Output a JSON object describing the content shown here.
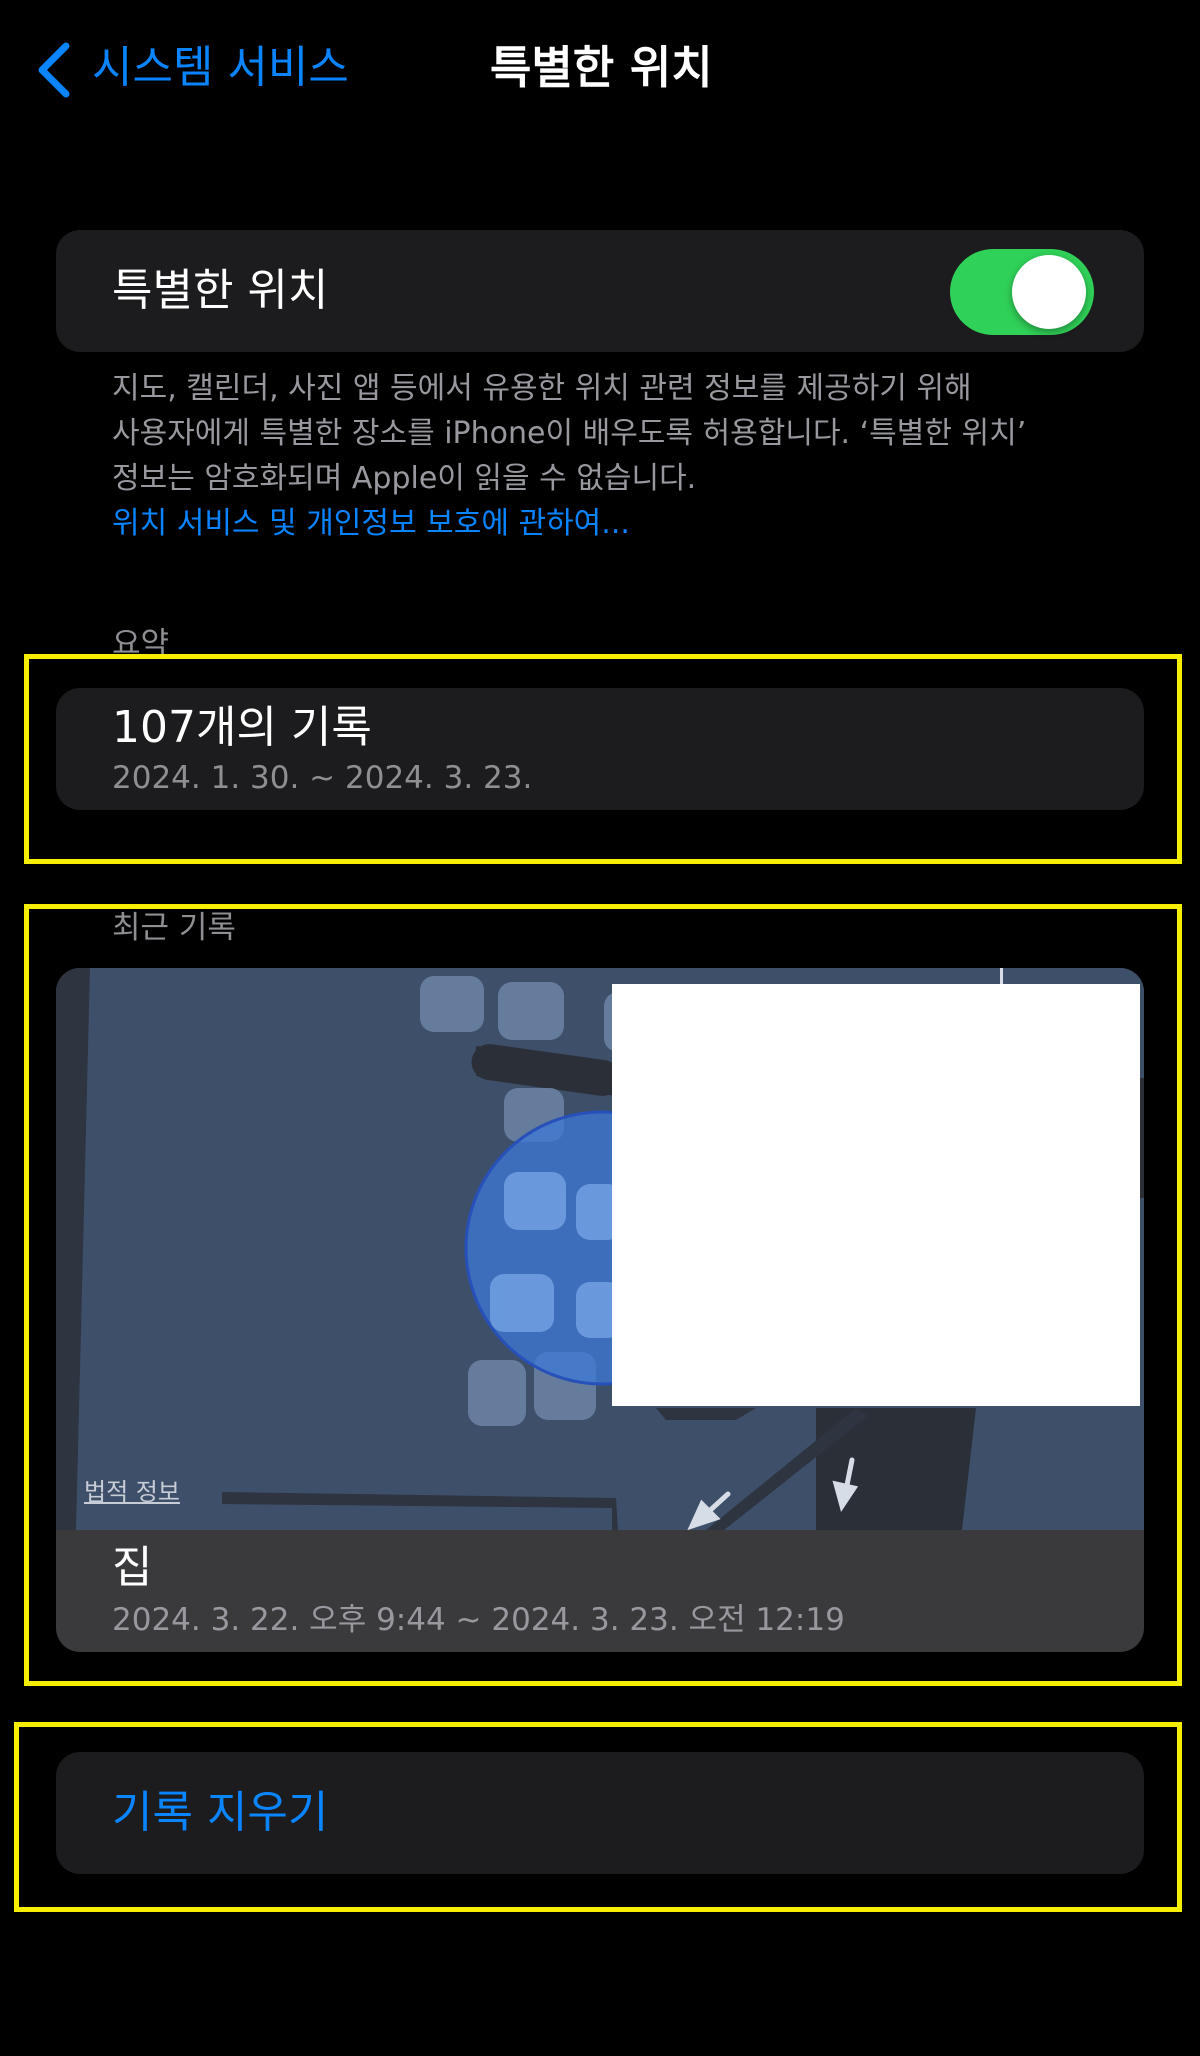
{
  "nav": {
    "back_label": "시스템 서비스",
    "title": "특별한 위치"
  },
  "toggle": {
    "label": "특별한 위치",
    "state": "on"
  },
  "description": {
    "lines": [
      "지도, 캘린더, 사진 앱 등에서 유용한 위치 관련 정보를 제공하기 위해",
      "사용자에게 특별한 장소를 iPhone이 배우도록 허용합니다. ‘특별한 위치’",
      "정보는 암호화되며 Apple이 읽을 수 없습니다."
    ],
    "link": "위치 서비스 및 개인정보 보호에 관하여..."
  },
  "summary": {
    "header": "요약",
    "title": "107개의 기록",
    "date_range": "2024. 1. 30. ~ 2024. 3. 23."
  },
  "recent": {
    "header": "최근 기록",
    "legal_info": "법적 정보",
    "record_title": "집",
    "record_time": "2024. 3. 22. 오후 9:44 ~ 2024. 3. 23. 오전 12:19"
  },
  "clear": {
    "label": "기록 지우기"
  },
  "colors": {
    "accent": "#0a84ff",
    "switch_on": "#30d158",
    "highlight": "#f5ee00",
    "card": "#1c1c1e"
  },
  "icons": {
    "back": "chevron-left-icon",
    "map_arrows": "direction-arrow-icon"
  }
}
